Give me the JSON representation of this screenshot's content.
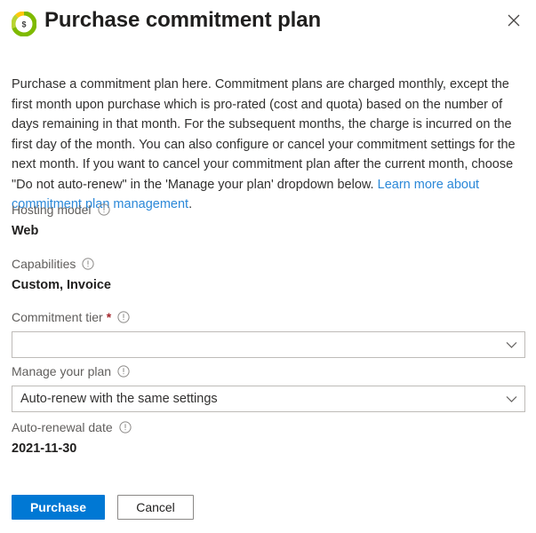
{
  "header": {
    "title": "Purchase commitment plan",
    "brand_icon": "cost-dollar-donut-icon",
    "close_icon": "close-icon",
    "close_label": "Close"
  },
  "description": {
    "part1": "Purchase a commitment plan here. Commitment plans are charged monthly, except the first month upon purchase which is pro-rated (cost and quota) based on the number of days remaining in that month. For the subsequent months, the charge is incurred on the first day of the month. You can also configure or cancel your commitment settings for the next month. If you want to cancel your commitment plan after the current month, choose \"Do not auto-renew\" in the 'Manage your plan' dropdown below. ",
    "link_text": "Learn more about commitment plan management",
    "part2": "."
  },
  "fields": {
    "hosting_model": {
      "label": "Hosting model",
      "info_icon": "info-icon",
      "value": "Web"
    },
    "capabilities": {
      "label": "Capabilities",
      "info_icon": "info-icon",
      "value": "Custom, Invoice"
    },
    "commitment_tier": {
      "label": "Commitment tier",
      "required_marker": "*",
      "info_icon": "info-icon",
      "value": "",
      "chevron_icon": "chevron-down-icon"
    },
    "manage_your_plan": {
      "label": "Manage your plan",
      "info_icon": "info-icon",
      "value": "Auto-renew with the same settings",
      "chevron_icon": "chevron-down-icon"
    },
    "auto_renewal_date": {
      "label": "Auto-renewal date",
      "info_icon": "info-icon",
      "value": "2021-11-30"
    }
  },
  "footer": {
    "purchase_label": "Purchase",
    "cancel_label": "Cancel"
  },
  "colors": {
    "accent": "#0078d4",
    "link": "#2b88d8",
    "required": "#a4262c",
    "label": "#605e5c",
    "text": "#323130",
    "border": "#bebbb8"
  }
}
